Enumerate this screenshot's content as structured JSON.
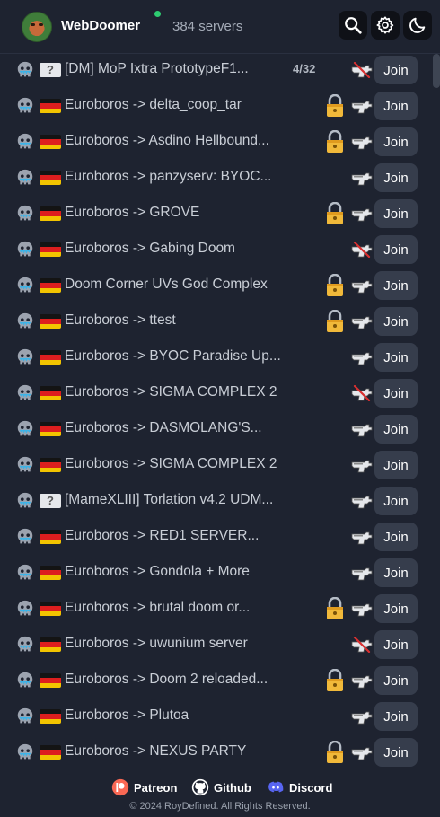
{
  "header": {
    "title": "WebDoomer",
    "server_count": "384 servers",
    "status_color": "#2ecc71",
    "buttons": [
      "search-icon",
      "gear-icon",
      "moon-icon"
    ]
  },
  "servers": [
    {
      "flag": "unknown",
      "flag_text": "?",
      "name": "[DM] MoP Ixtra PrototypeF1...",
      "players": "4/32",
      "locked": false,
      "gun": "no-gun-icon",
      "join": "Join"
    },
    {
      "flag": "de",
      "name": "Euroboros -> delta_coop_tar",
      "players": "",
      "locked": true,
      "gun": "gun-icon",
      "join": "Join"
    },
    {
      "flag": "de",
      "name": "Euroboros -> Asdino Hellbound...",
      "players": "",
      "locked": true,
      "gun": "gun-icon",
      "join": "Join"
    },
    {
      "flag": "de",
      "name": "Euroboros -> panzyserv: BYOC...",
      "players": "",
      "locked": false,
      "gun": "gun-icon",
      "join": "Join"
    },
    {
      "flag": "de",
      "name": "Euroboros -> GROVE",
      "players": "",
      "locked": true,
      "gun": "gun-icon",
      "join": "Join"
    },
    {
      "flag": "de",
      "name": "Euroboros -> Gabing Doom",
      "players": "",
      "locked": false,
      "gun": "no-gun-icon",
      "join": "Join"
    },
    {
      "flag": "de",
      "name": "Doom Corner UVs God Complex",
      "players": "",
      "locked": true,
      "gun": "gun-icon",
      "join": "Join"
    },
    {
      "flag": "de",
      "name": "Euroboros -> ttest",
      "players": "",
      "locked": true,
      "gun": "gun-icon",
      "join": "Join"
    },
    {
      "flag": "de",
      "name": "Euroboros -> BYOC Paradise Up...",
      "players": "",
      "locked": false,
      "gun": "gun-icon",
      "join": "Join"
    },
    {
      "flag": "de",
      "name": "Euroboros -> SIGMA COMPLEX 2",
      "players": "",
      "locked": false,
      "gun": "no-gun-icon",
      "join": "Join"
    },
    {
      "flag": "de",
      "name": "Euroboros -> DASMOLANG'S...",
      "players": "",
      "locked": false,
      "gun": "gun-icon",
      "join": "Join"
    },
    {
      "flag": "de",
      "name": "Euroboros -> SIGMA COMPLEX 2",
      "players": "",
      "locked": false,
      "gun": "gun-icon",
      "join": "Join"
    },
    {
      "flag": "unknown",
      "flag_text": "?",
      "name": "[MameXLIII] Torlation v4.2 UDM...",
      "players": "",
      "locked": false,
      "gun": "gun-icon",
      "join": "Join"
    },
    {
      "flag": "de",
      "name": "Euroboros -> RED1 SERVER...",
      "players": "",
      "locked": false,
      "gun": "gun-icon",
      "join": "Join"
    },
    {
      "flag": "de",
      "name": "Euroboros -> Gondola + More",
      "players": "",
      "locked": false,
      "gun": "gun-icon",
      "join": "Join"
    },
    {
      "flag": "de",
      "name": "Euroboros -> brutal doom or...",
      "players": "",
      "locked": true,
      "gun": "gun-icon",
      "join": "Join"
    },
    {
      "flag": "de",
      "name": "Euroboros -> uwunium server",
      "players": "",
      "locked": false,
      "gun": "no-gun-icon",
      "join": "Join"
    },
    {
      "flag": "de",
      "name": "Euroboros -> Doom 2 reloaded...",
      "players": "",
      "locked": true,
      "gun": "gun-icon",
      "join": "Join"
    },
    {
      "flag": "de",
      "name": "Euroboros -> Plutoa",
      "players": "",
      "locked": false,
      "gun": "gun-icon",
      "join": "Join"
    },
    {
      "flag": "de",
      "name": "Euroboros -> NEXUS PARTY",
      "players": "",
      "locked": true,
      "gun": "gun-icon",
      "join": "Join"
    }
  ],
  "footer": {
    "links": [
      {
        "label": "Patreon",
        "icon": "patreon-icon",
        "color": "#f96854"
      },
      {
        "label": "Github",
        "icon": "github-icon",
        "color": "#ffffff"
      },
      {
        "label": "Discord",
        "icon": "discord-icon",
        "color": "#5865f2"
      }
    ],
    "copyright": "© 2024 RoyDefined. All Rights Reserved."
  }
}
